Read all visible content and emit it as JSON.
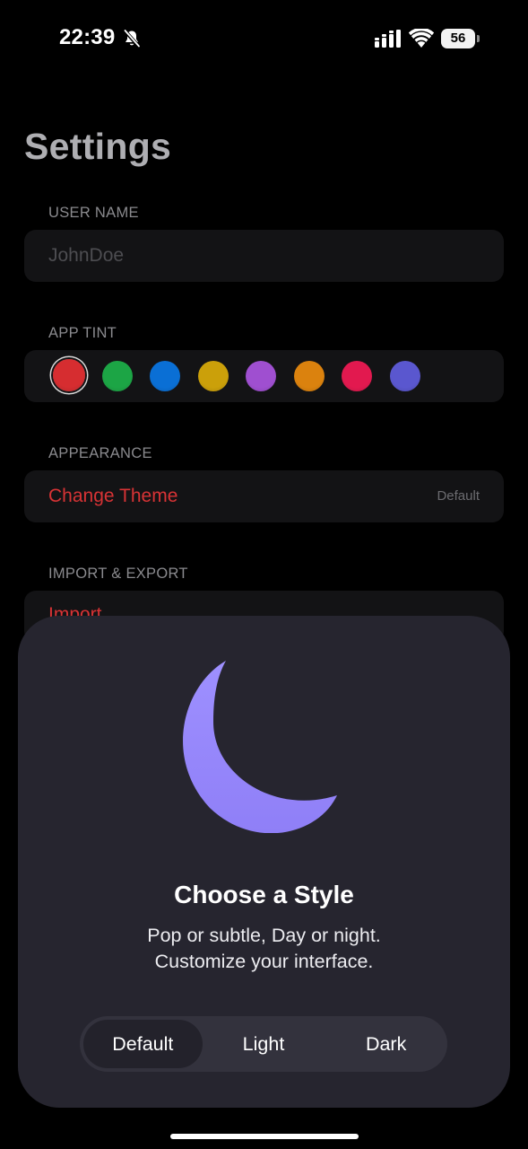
{
  "status_bar": {
    "time": "22:39",
    "battery": "56"
  },
  "settings": {
    "title": "Settings",
    "user_name": {
      "header": "USER NAME",
      "placeholder": "JohnDoe",
      "value": ""
    },
    "app_tint": {
      "header": "APP TINT",
      "selected_index": 0,
      "colors": [
        "#d62d30",
        "#1ca545",
        "#0a6fd5",
        "#cba00a",
        "#9f4fd0",
        "#db820e",
        "#e2194f",
        "#5a57cf"
      ]
    },
    "appearance": {
      "header": "APPEARANCE",
      "change_theme_label": "Change Theme",
      "change_theme_value": "Default",
      "accent_color": "#d83335"
    },
    "import_export": {
      "header": "IMPORT & EXPORT",
      "import_label": "Import"
    }
  },
  "sheet": {
    "icon": "moon-icon",
    "moon_color": "#9b8bff",
    "title": "Choose a Style",
    "subtitle_line1": "Pop or subtle, Day or night.",
    "subtitle_line2": "Customize your interface.",
    "options": [
      "Default",
      "Light",
      "Dark"
    ],
    "selected_option": "Default"
  }
}
